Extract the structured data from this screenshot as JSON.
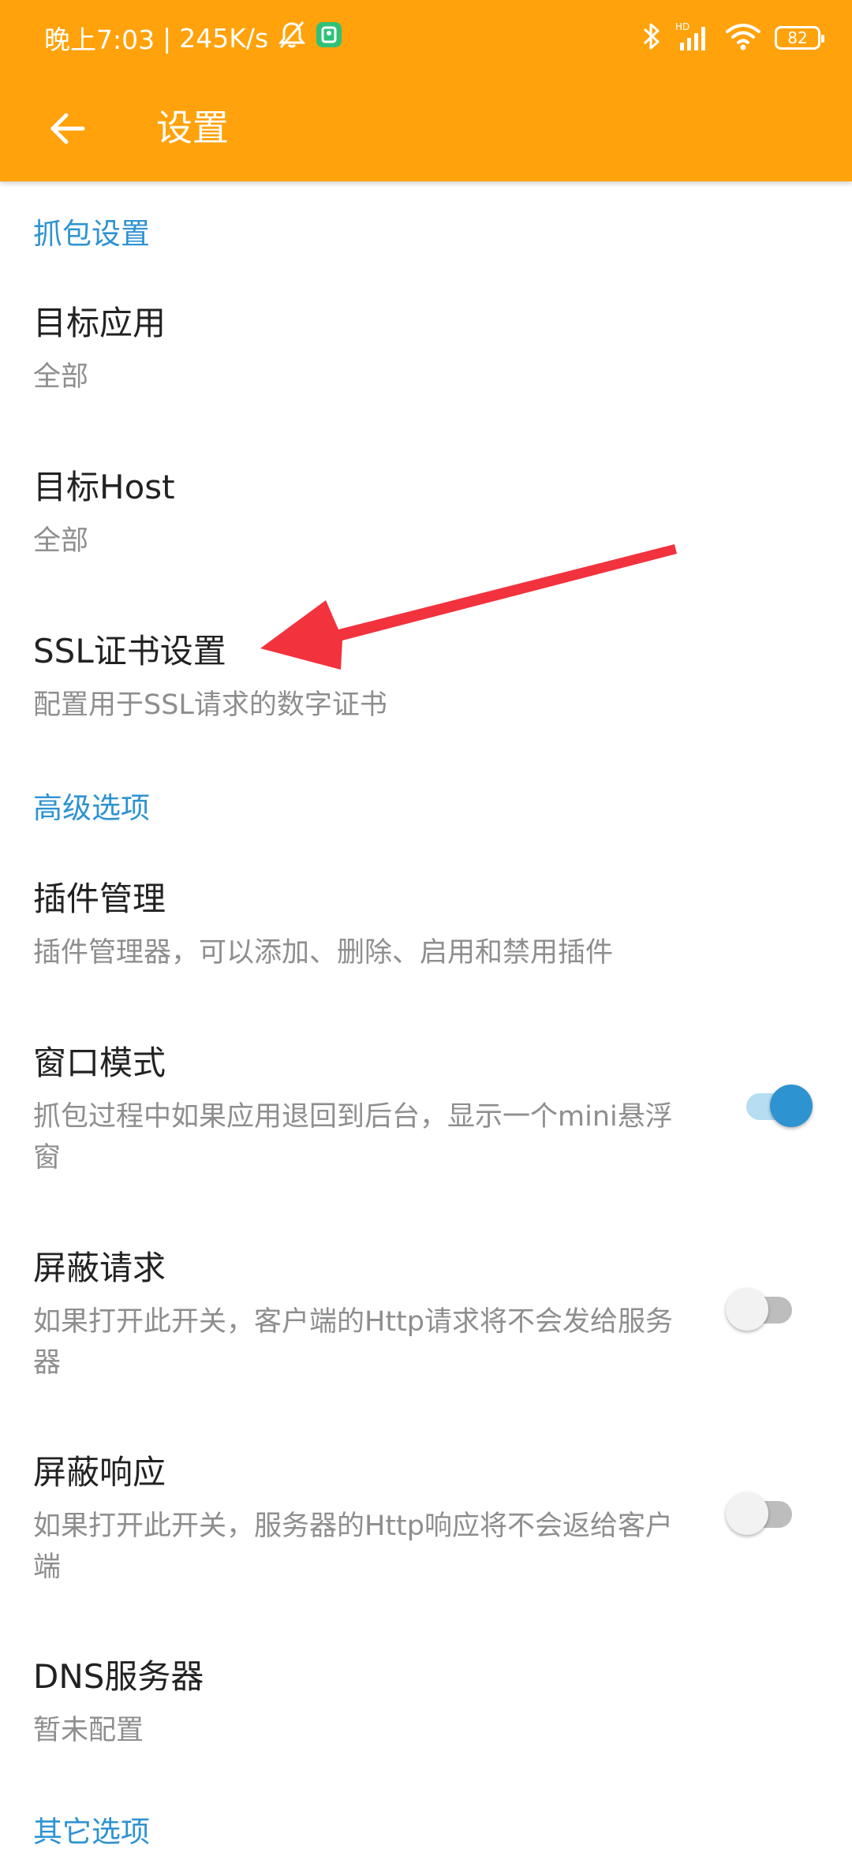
{
  "status_bar": {
    "time": "晚上7:03",
    "separator": "|",
    "net_speed": "245K/s",
    "battery": "82",
    "icons": [
      "mute-bell-icon",
      "app-notification-icon",
      "bluetooth-icon",
      "hd-signal-icon",
      "wifi-icon",
      "battery-icon"
    ]
  },
  "toolbar": {
    "title": "设置",
    "back_icon": "arrow-left-icon"
  },
  "sections": {
    "capture": {
      "header": "抓包设置"
    },
    "advanced": {
      "header": "高级选项"
    },
    "other": {
      "header": "其它选项"
    }
  },
  "items": {
    "target_app": {
      "title": "目标应用",
      "summary": "全部"
    },
    "target_host": {
      "title": "目标Host",
      "summary": "全部"
    },
    "ssl": {
      "title": "SSL证书设置",
      "summary": "配置用于SSL请求的数字证书"
    },
    "plugins": {
      "title": "插件管理",
      "summary": "插件管理器，可以添加、删除、启用和禁用插件"
    },
    "window_mode": {
      "title": "窗口模式",
      "summary": "抓包过程中如果应用退回到后台，显示一个mini悬浮窗",
      "switch_on": true
    },
    "block_request": {
      "title": "屏蔽请求",
      "summary": "如果打开此开关，客户端的Http请求将不会发给服务器",
      "switch_on": false
    },
    "block_response": {
      "title": "屏蔽响应",
      "summary": "如果打开此开关，服务器的Http响应将不会返给客户端",
      "switch_on": false
    },
    "dns": {
      "title": "DNS服务器",
      "summary": "暂未配置"
    }
  },
  "colors": {
    "appbar": "#FFA20B",
    "accent": "#2E93D1",
    "annotation_arrow": "#F2323D"
  }
}
